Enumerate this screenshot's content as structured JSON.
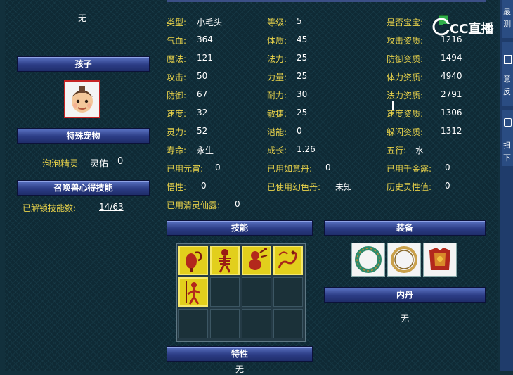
{
  "left": {
    "none_top": "无",
    "child_header": "孩子",
    "special_pet_header": "特殊宠物",
    "special_pet_name": "泡泡精灵",
    "special_pet_stat_label": "灵佑",
    "special_pet_stat_value": "0",
    "summon_skill_header": "召唤兽心得技能",
    "unlocked_label": "已解锁技能数:",
    "unlocked_value": "14/63"
  },
  "stats": {
    "type_label": "类型:",
    "type_value": "小毛头",
    "level_label": "等级:",
    "level_value": "5",
    "baby_label": "是否宝宝:",
    "hp_label": "气血:",
    "hp_value": "364",
    "con_label": "体质:",
    "con_value": "45",
    "atk_apt_label": "攻击资质:",
    "atk_apt_value": "1216",
    "mp_label": "魔法:",
    "mp_value": "121",
    "mag_label": "法力:",
    "mag_value": "25",
    "def_apt_label": "防御资质:",
    "def_apt_value": "1494",
    "atk_label": "攻击:",
    "atk_value": "50",
    "str_label": "力量:",
    "str_value": "25",
    "hp_apt_label": "体力资质:",
    "hp_apt_value": "4940",
    "def_label": "防御:",
    "def_value": "67",
    "end_label": "耐力:",
    "end_value": "30",
    "mag_apt_label": "法力资质:",
    "mag_apt_value": "2791",
    "spd_label": "速度:",
    "spd_value": "32",
    "agi_label": "敏捷:",
    "agi_value": "25",
    "spd_apt_label": "速度资质:",
    "spd_apt_value": "1306",
    "spirit_label": "灵力:",
    "spirit_value": "52",
    "potential_label": "潜能:",
    "potential_value": "0",
    "dodge_apt_label": "躲闪资质:",
    "dodge_apt_value": "1312",
    "life_label": "寿命:",
    "life_value": "永生",
    "growth_label": "成长:",
    "growth_value": "1.26",
    "element_label": "五行:",
    "element_value": "水",
    "yuanxiao_label": "已用元宵:",
    "yuanxiao_value": "0",
    "ruyi_label": "已用如意丹:",
    "ruyi_value": "0",
    "qianjin_label": "已用千金露:",
    "qianjin_value": "0",
    "wuxing_label": "悟性:",
    "wuxing_value": "0",
    "huanse_label": "已使用幻色丹:",
    "huanse_value": "未知",
    "history_label": "历史灵性值:",
    "history_value": "0",
    "qingling_label": "已用清灵仙露:",
    "qingling_value": "0"
  },
  "sections": {
    "skills_header": "技能",
    "equipment_header": "装备",
    "neidan_header": "内丹",
    "neidan_value": "无",
    "traits_header": "特性",
    "traits_value": "无"
  },
  "sidebar": {
    "chars_top": [
      "最",
      "测"
    ],
    "chars_mid": [
      "意",
      "反"
    ],
    "chars_bot": [
      "扫",
      "下"
    ]
  },
  "logo": {
    "text": "CC直播"
  },
  "colors": {
    "label": "#e8d24a",
    "value": "#ffffff",
    "header_bar": "#2c3d85",
    "background": "#0f2a35"
  },
  "skill_slots": {
    "filled": 5,
    "total": 12
  }
}
